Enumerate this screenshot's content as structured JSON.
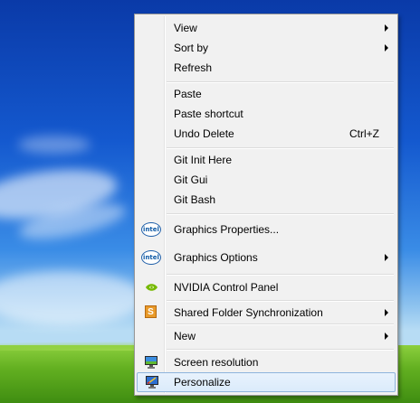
{
  "menu": {
    "items": [
      {
        "label": "View",
        "has_submenu": true
      },
      {
        "label": "Sort by",
        "has_submenu": true
      },
      {
        "label": "Refresh"
      },
      {
        "label": "Paste"
      },
      {
        "label": "Paste shortcut"
      },
      {
        "label": "Undo Delete",
        "shortcut": "Ctrl+Z"
      },
      {
        "label": "Git Init Here"
      },
      {
        "label": "Git Gui"
      },
      {
        "label": "Git Bash"
      },
      {
        "label": "Graphics Properties...",
        "icon": "intel-icon",
        "icon_text": "intel"
      },
      {
        "label": "Graphics Options",
        "icon": "intel-icon",
        "icon_text": "intel",
        "has_submenu": true
      },
      {
        "label": "NVIDIA Control Panel",
        "icon": "nvidia-icon"
      },
      {
        "label": "Shared Folder Synchronization",
        "icon": "shared-folder-sync-icon",
        "icon_text": "S",
        "has_submenu": true
      },
      {
        "label": "New",
        "has_submenu": true
      },
      {
        "label": "Screen resolution",
        "icon": "monitor-icon"
      },
      {
        "label": "Personalize",
        "icon": "personalize-monitor-icon",
        "highlighted": true
      }
    ]
  },
  "colors": {
    "menu_background": "#f1f1f1",
    "highlight_border": "#8eb4dc",
    "nvidia_green": "#76b900",
    "intel_blue": "#0f5aa6"
  }
}
